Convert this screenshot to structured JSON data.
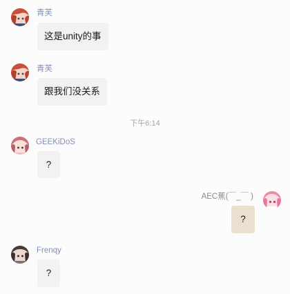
{
  "messages": [
    {
      "sender": "青芙",
      "text": "这是unity的事",
      "avatar": "avatar-qingfu-icon"
    },
    {
      "sender": "青芙",
      "text": "跟我们没关系",
      "avatar": "avatar-qingfu-icon"
    },
    {
      "sender": "GEEKiDoS",
      "text": "?",
      "avatar": "avatar-geekidos-icon"
    },
    {
      "sender": "AEC蕉(￣_￣ )",
      "text": "?",
      "avatar": "avatar-aec-icon",
      "self": true
    },
    {
      "sender": "Frenqy",
      "text": "?",
      "avatar": "avatar-frenqy-icon"
    }
  ],
  "divider_time": "下午6:14",
  "colors": {
    "name": "#7f8fb5",
    "bubble": "#f2f2f3",
    "self_bubble": "#ebdfcf",
    "time": "#a4a4a4"
  }
}
